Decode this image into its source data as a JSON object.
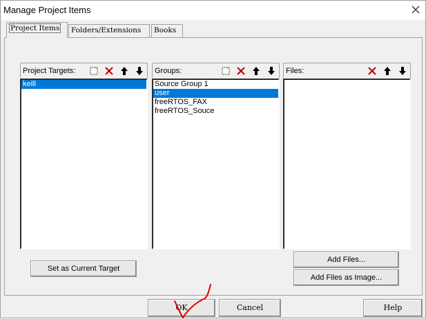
{
  "window": {
    "title": "Manage Project Items"
  },
  "tabs": [
    {
      "label": "Project Items",
      "active": true
    },
    {
      "label": "Folders/Extensions",
      "active": false
    },
    {
      "label": "Books",
      "active": false
    }
  ],
  "targets": {
    "label": "Project Targets:",
    "items": [
      "keill"
    ],
    "selected": 0
  },
  "groups": {
    "label": "Groups:",
    "items": [
      "Source Group 1",
      "user",
      "freeRTOS_FAX",
      "freeRTOS_Souce"
    ],
    "selected": 1
  },
  "files": {
    "label": "Files:",
    "items": []
  },
  "buttons": {
    "set_current_target": "Set as Current Target",
    "add_files": "Add Files...",
    "add_files_image": "Add Files as Image...",
    "ok": "OK",
    "cancel": "Cancel",
    "help": "Help"
  },
  "colors": {
    "selection": "#0078d7",
    "delete_icon": "#c00000",
    "annotation": "#e00000"
  }
}
